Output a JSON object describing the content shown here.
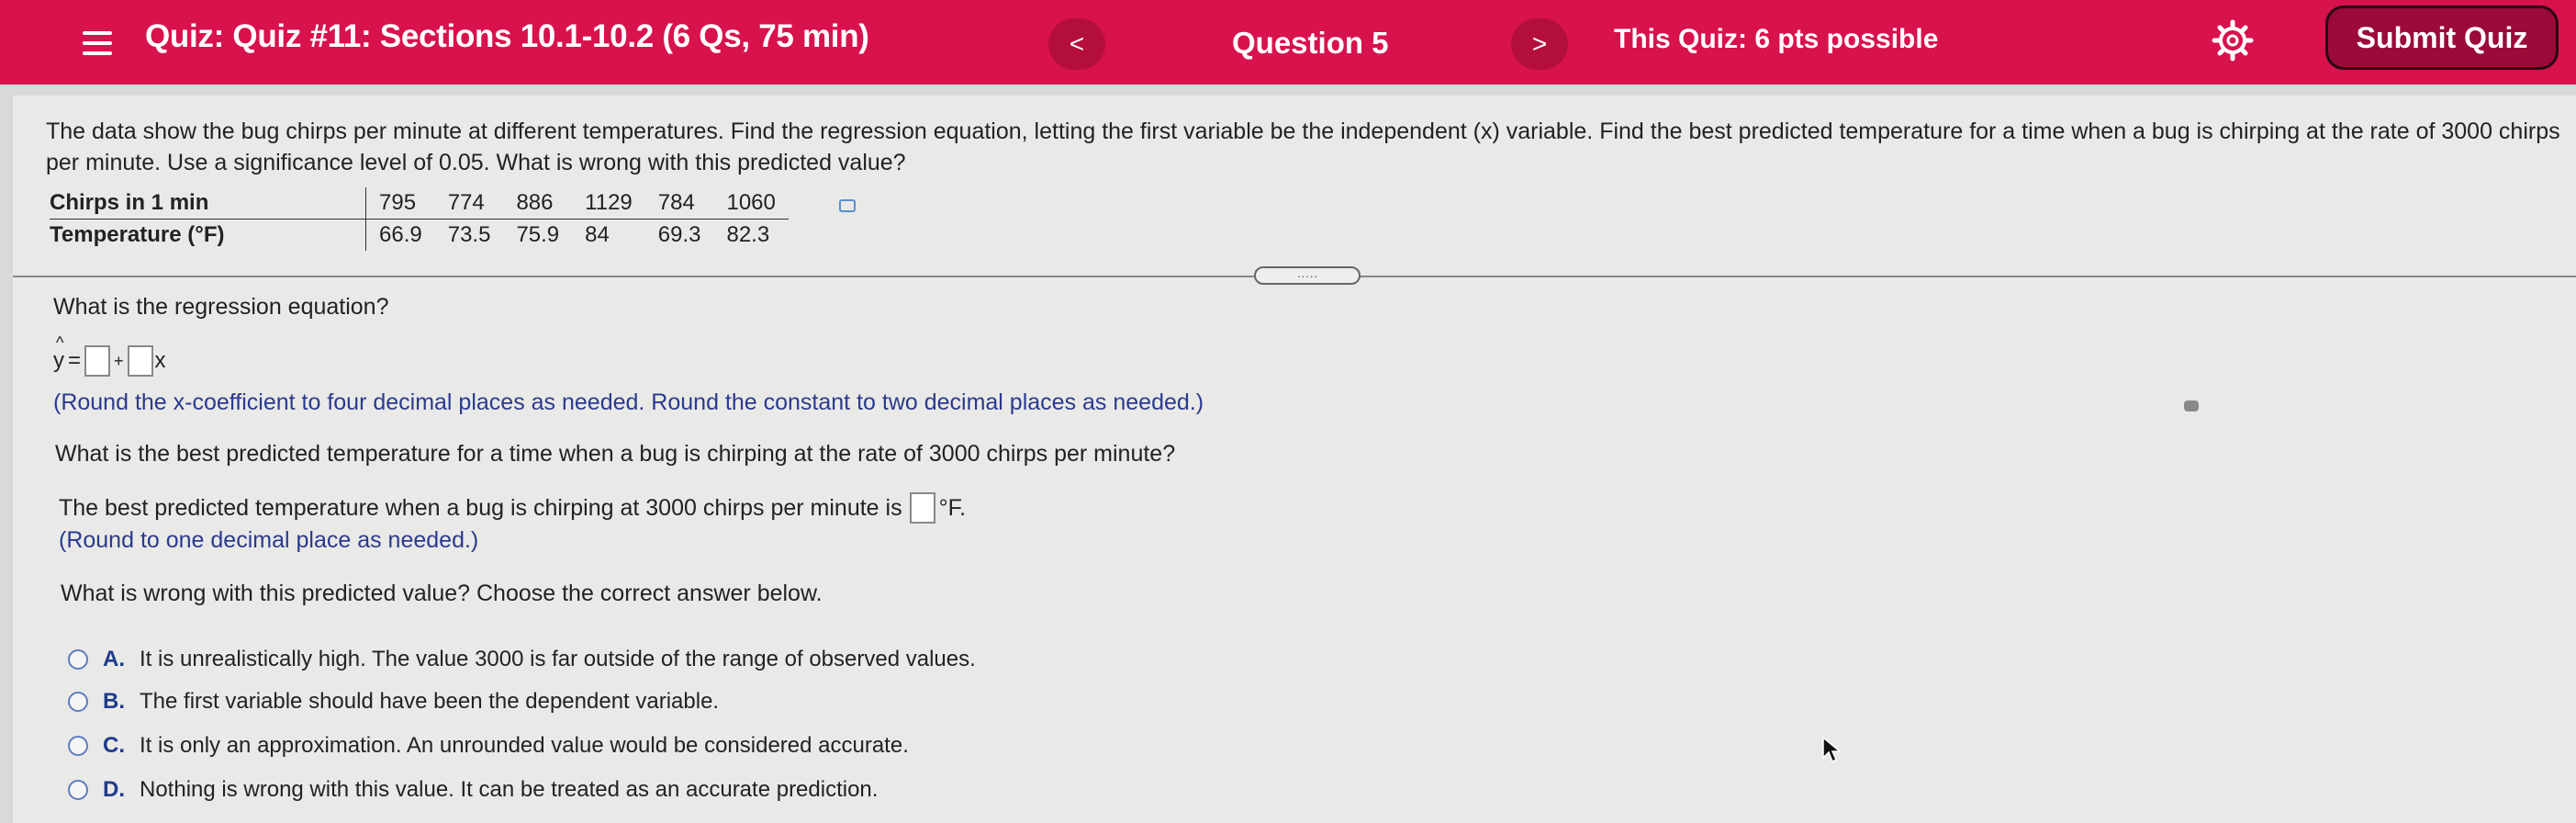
{
  "header": {
    "title": "Quiz: Quiz #11: Sections 10.1-10.2 (6 Qs, 75 min)",
    "prev_label": "<",
    "question_label": "Question 5",
    "next_label": ">",
    "points": "This Quiz: 6 pts possible",
    "submit_label": "Submit Quiz",
    "bar_color": "#d8124d"
  },
  "question": {
    "text": "The data show the bug chirps per minute at different temperatures. Find the regression equation, letting the first variable be the independent (x) variable. Find the best predicted temperature for a time when a bug is chirping at the rate of 3000 chirps per minute. Use a significance level of 0.05. What is wrong with this predicted value?",
    "table": {
      "rows": [
        {
          "label": "Chirps in 1 min",
          "values": [
            "795",
            "774",
            "886",
            "1129",
            "784",
            "1060"
          ]
        },
        {
          "label": "Temperature (°F)",
          "values": [
            "66.9",
            "73.5",
            "75.9",
            "84",
            "69.3",
            "82.3"
          ]
        }
      ]
    }
  },
  "handle_text": "·····",
  "part1": {
    "prompt": "What is the regression equation?",
    "eq_y": "y",
    "eq_hat": "^",
    "eq_eq": "=",
    "eq_plus": "+",
    "eq_x": "x",
    "hint": "(Round the x-coefficient to four decimal places as needed. Round the constant to two decimal places as needed.)"
  },
  "part2": {
    "prompt": "What is the best predicted temperature for a time when a bug is chirping at the rate of 3000 chirps per minute?",
    "answer_prefix": "The best predicted temperature when a bug is chirping at 3000 chirps per minute is",
    "answer_suffix": "°F.",
    "hint": "(Round to one decimal place as needed.)"
  },
  "part3": {
    "prompt": "What is wrong with this predicted value? Choose the correct answer below.",
    "choices": [
      {
        "letter": "A.",
        "text": "It is unrealistically high. The value 3000 is far outside of the range of observed values."
      },
      {
        "letter": "B.",
        "text": "The first variable should have been the dependent variable."
      },
      {
        "letter": "C.",
        "text": "It is only an approximation. An unrounded value would be considered accurate."
      },
      {
        "letter": "D.",
        "text": "Nothing is wrong with this value. It can be treated as an accurate prediction."
      }
    ]
  }
}
